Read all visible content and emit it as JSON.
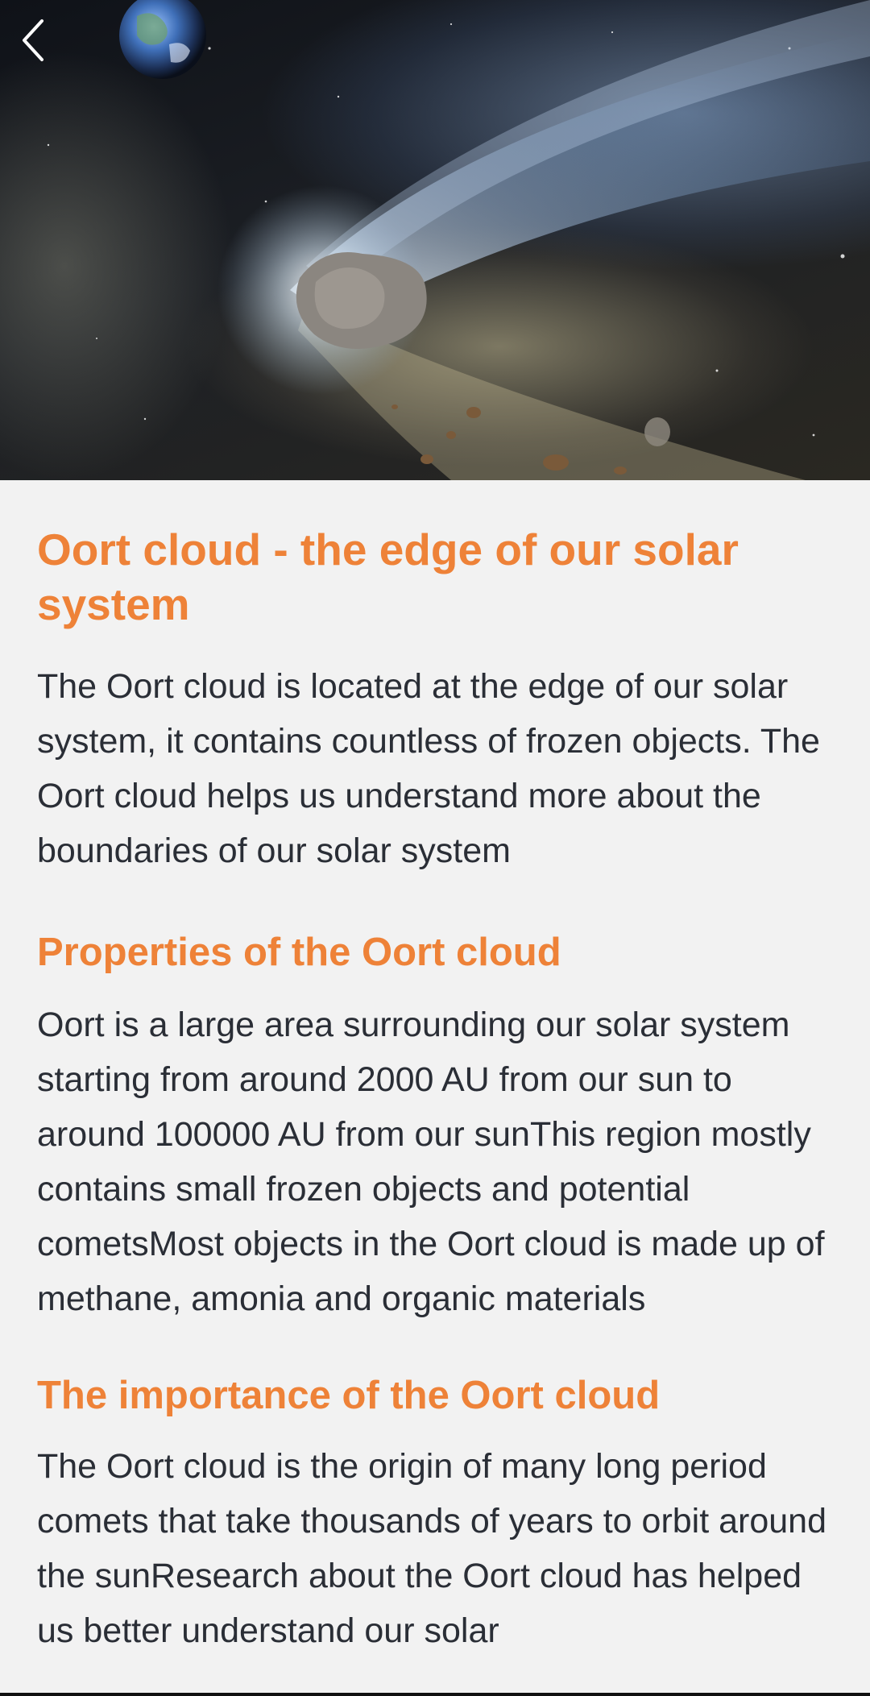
{
  "header": {
    "back_icon": "chevron-left-icon",
    "hero_image": "comet-illustration"
  },
  "article": {
    "title": "Oort cloud - the edge of our solar system",
    "intro": "The Oort cloud is located at the edge of our solar system, it contains countless of frozen objects. The Oort cloud helps us understand more about the boundaries of our solar system",
    "sections": [
      {
        "heading": "Properties of the Oort cloud",
        "body": "Oort is a large area surrounding our solar system starting from around 2000 AU from our sun to around 100000 AU from our sunThis region mostly contains small frozen objects and potential cometsMost objects in the Oort cloud is made up of methane, amonia and organic materials"
      },
      {
        "heading": "The importance of the Oort cloud",
        "body": "The Oort cloud is the origin of many long period comets that take thousands of years to orbit around the sunResearch about the Oort cloud has helped us better understand our solar"
      }
    ]
  },
  "colors": {
    "accent": "#ee8238",
    "text": "#2a2e36",
    "background": "#f2f2f2"
  }
}
